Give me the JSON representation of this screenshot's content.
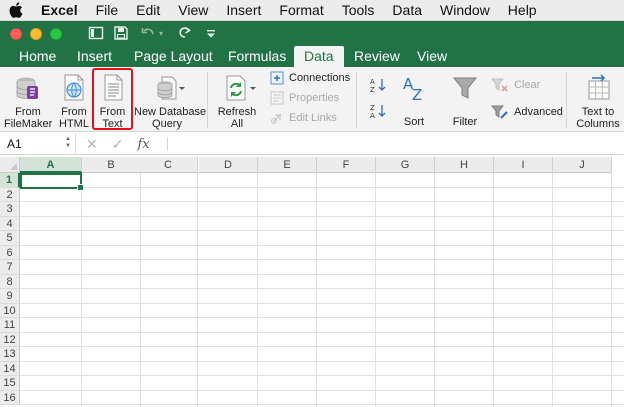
{
  "menubar": {
    "app_name": "Excel",
    "items": [
      "File",
      "Edit",
      "View",
      "Insert",
      "Format",
      "Tools",
      "Data",
      "Window",
      "Help"
    ]
  },
  "ribbon_tabs": [
    "Home",
    "Insert",
    "Page Layout",
    "Formulas",
    "Data",
    "Review",
    "View"
  ],
  "active_tab": "Data",
  "ribbon": {
    "from_filemaker": [
      "From",
      "FileMaker"
    ],
    "from_html": [
      "From",
      "HTML"
    ],
    "from_text": [
      "From",
      "Text"
    ],
    "new_database_query": [
      "New Database",
      "Query"
    ],
    "refresh_all": [
      "Refresh",
      "All"
    ],
    "connections": "Connections",
    "properties": "Properties",
    "edit_links": "Edit Links",
    "sort": "Sort",
    "filter": "Filter",
    "clear": "Clear",
    "advanced": "Advanced",
    "text_to_columns": [
      "Text to",
      "Columns"
    ]
  },
  "formula_bar": {
    "name_box": "A1",
    "fx": "fx",
    "cancel": "✕",
    "enter": "✓",
    "value": ""
  },
  "grid": {
    "columns": [
      "A",
      "B",
      "C",
      "D",
      "E",
      "F",
      "G",
      "H",
      "I",
      "J"
    ],
    "rows": [
      "1",
      "2",
      "3",
      "4",
      "5",
      "6",
      "7",
      "8",
      "9",
      "10",
      "11",
      "12",
      "13",
      "14",
      "15",
      "16"
    ],
    "selected_cell": "A1"
  },
  "colors": {
    "excel_green": "#217346",
    "highlight_red": "#e2121b"
  }
}
